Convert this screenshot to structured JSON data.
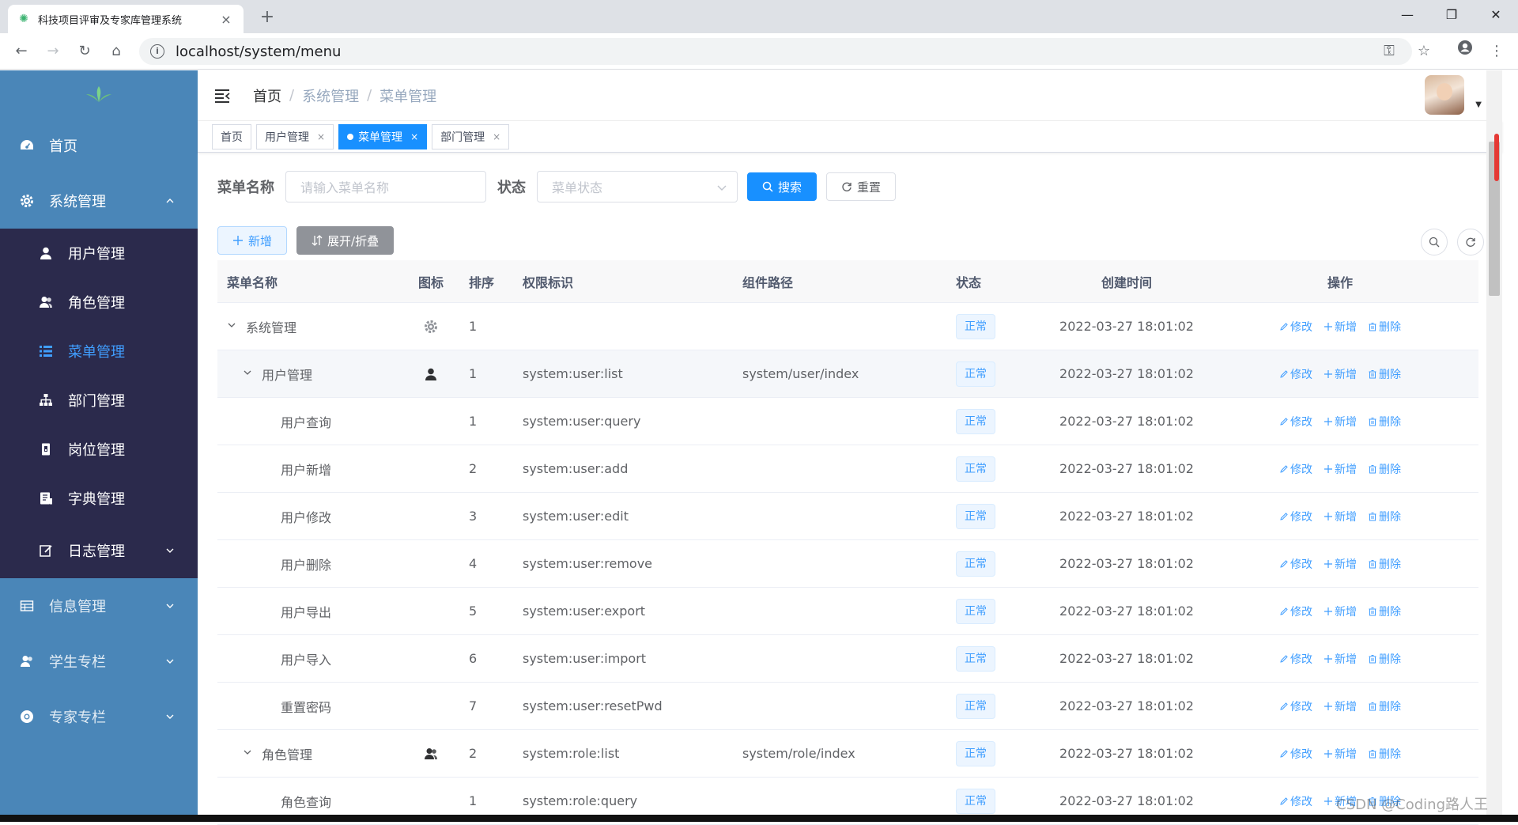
{
  "browser": {
    "tab_title": "科技项目评审及专家库管理系统",
    "url": "localhost/system/menu"
  },
  "sidebar": {
    "items": [
      {
        "label": "首页"
      },
      {
        "label": "系统管理"
      },
      {
        "label": "信息管理"
      },
      {
        "label": "学生专栏"
      },
      {
        "label": "专家专栏"
      }
    ],
    "sub_items": [
      {
        "label": "用户管理"
      },
      {
        "label": "角色管理"
      },
      {
        "label": "菜单管理"
      },
      {
        "label": "部门管理"
      },
      {
        "label": "岗位管理"
      },
      {
        "label": "字典管理"
      },
      {
        "label": "日志管理"
      }
    ]
  },
  "navbar": {
    "breadcrumb": [
      "首页",
      "系统管理",
      "菜单管理"
    ]
  },
  "tags": [
    {
      "label": "首页"
    },
    {
      "label": "用户管理"
    },
    {
      "label": "菜单管理"
    },
    {
      "label": "部门管理"
    }
  ],
  "search": {
    "name_label": "菜单名称",
    "name_placeholder": "请输入菜单名称",
    "status_label": "状态",
    "status_placeholder": "菜单状态",
    "search_btn": "搜索",
    "reset_btn": "重置"
  },
  "actions": {
    "add_btn": "新增",
    "expand_btn": "展开/折叠"
  },
  "table": {
    "headers": [
      "菜单名称",
      "图标",
      "排序",
      "权限标识",
      "组件路径",
      "状态",
      "创建时间",
      "操作"
    ],
    "op_edit": "修改",
    "op_add": "新增",
    "op_delete": "删除",
    "rows": [
      {
        "name": "系统管理",
        "sort": "1",
        "perm": "",
        "path": "",
        "status": "正常",
        "time": "2022-03-27 18:01:02"
      },
      {
        "name": "用户管理",
        "sort": "1",
        "perm": "system:user:list",
        "path": "system/user/index",
        "status": "正常",
        "time": "2022-03-27 18:01:02"
      },
      {
        "name": "用户查询",
        "sort": "1",
        "perm": "system:user:query",
        "path": "",
        "status": "正常",
        "time": "2022-03-27 18:01:02"
      },
      {
        "name": "用户新增",
        "sort": "2",
        "perm": "system:user:add",
        "path": "",
        "status": "正常",
        "time": "2022-03-27 18:01:02"
      },
      {
        "name": "用户修改",
        "sort": "3",
        "perm": "system:user:edit",
        "path": "",
        "status": "正常",
        "time": "2022-03-27 18:01:02"
      },
      {
        "name": "用户删除",
        "sort": "4",
        "perm": "system:user:remove",
        "path": "",
        "status": "正常",
        "time": "2022-03-27 18:01:02"
      },
      {
        "name": "用户导出",
        "sort": "5",
        "perm": "system:user:export",
        "path": "",
        "status": "正常",
        "time": "2022-03-27 18:01:02"
      },
      {
        "name": "用户导入",
        "sort": "6",
        "perm": "system:user:import",
        "path": "",
        "status": "正常",
        "time": "2022-03-27 18:01:02"
      },
      {
        "name": "重置密码",
        "sort": "7",
        "perm": "system:user:resetPwd",
        "path": "",
        "status": "正常",
        "time": "2022-03-27 18:01:02"
      },
      {
        "name": "角色管理",
        "sort": "2",
        "perm": "system:role:list",
        "path": "system/role/index",
        "status": "正常",
        "time": "2022-03-27 18:01:02"
      },
      {
        "name": "角色查询",
        "sort": "1",
        "perm": "system:role:query",
        "path": "",
        "status": "正常",
        "time": "2022-03-27 18:01:02"
      }
    ]
  },
  "watermark": "CSDN @Coding路人王"
}
